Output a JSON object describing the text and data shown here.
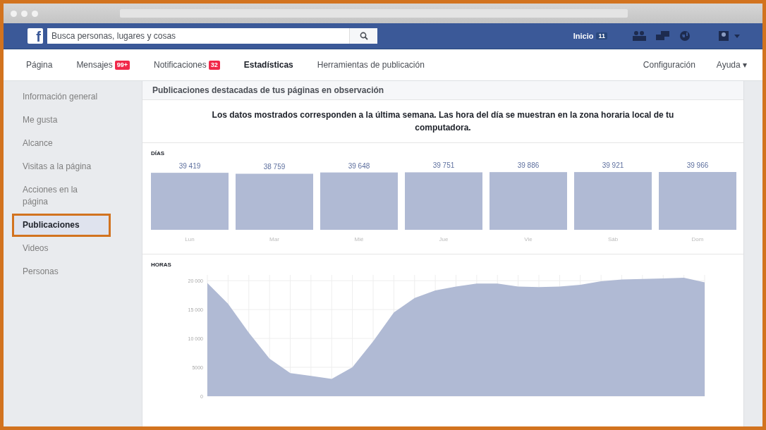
{
  "topbar": {
    "logo": "f",
    "search": {
      "placeholder": "Busca personas, lugares y cosas"
    },
    "home": {
      "label": "Inicio",
      "badge": "11"
    }
  },
  "tabs": [
    {
      "label": "Página",
      "selected": false
    },
    {
      "label": "Mensajes",
      "badge": "99+",
      "selected": false
    },
    {
      "label": "Notificaciones",
      "badge": "32",
      "selected": false
    },
    {
      "label": "Estadísticas",
      "selected": true
    },
    {
      "label": "Herramientas de publicación",
      "selected": false
    }
  ],
  "tabs_right": [
    {
      "label": "Configuración"
    },
    {
      "label": "Ayuda ▾"
    }
  ],
  "sidebar": {
    "items": [
      {
        "label": "Información general",
        "selected": false
      },
      {
        "label": "Me gusta",
        "selected": false
      },
      {
        "label": "Alcance",
        "selected": false
      },
      {
        "label": "Visitas a la página",
        "selected": false
      },
      {
        "label": "Acciones en la página",
        "selected": false
      },
      {
        "label": "Publicaciones",
        "selected": true
      },
      {
        "label": "Videos",
        "selected": false
      },
      {
        "label": "Personas",
        "selected": false
      }
    ]
  },
  "panel": {
    "title": "Publicaciones destacadas de tus páginas en observación",
    "notice": "Los datos mostrados corresponden a la última semana. Las hora del día se muestran en la zona horaria local de tu computadora.",
    "days": {
      "label": "DÍAS",
      "chart_data": {
        "type": "bar",
        "categories": [
          "Lun",
          "Mar",
          "Mié",
          "Jue",
          "Vie",
          "Sáb",
          "Dom"
        ],
        "values": [
          39419,
          38759,
          39648,
          39751,
          39886,
          39921,
          39966
        ],
        "value_labels": [
          "39 419",
          "38 759",
          "39 648",
          "39 751",
          "39 886",
          "39 921",
          "39 966"
        ],
        "data_labels": true
      }
    },
    "hours": {
      "label": "HORAS",
      "chart_data": {
        "type": "area",
        "grid": true,
        "values": [
          19600,
          16000,
          11000,
          6500,
          4000,
          3500,
          3000,
          5000,
          9500,
          14500,
          17000,
          18300,
          19000,
          19500,
          19500,
          19000,
          18900,
          19000,
          19300,
          19900,
          20200,
          20300,
          20400,
          20500,
          19700
        ],
        "ylim": [
          0,
          21000
        ],
        "yticks": [
          {
            "value": 0,
            "label": "0"
          },
          {
            "value": 5000,
            "label": "5000"
          },
          {
            "value": 10000,
            "label": "10 000"
          },
          {
            "value": 15000,
            "label": "15 000"
          },
          {
            "value": 20000,
            "label": "20 000"
          }
        ]
      }
    }
  }
}
